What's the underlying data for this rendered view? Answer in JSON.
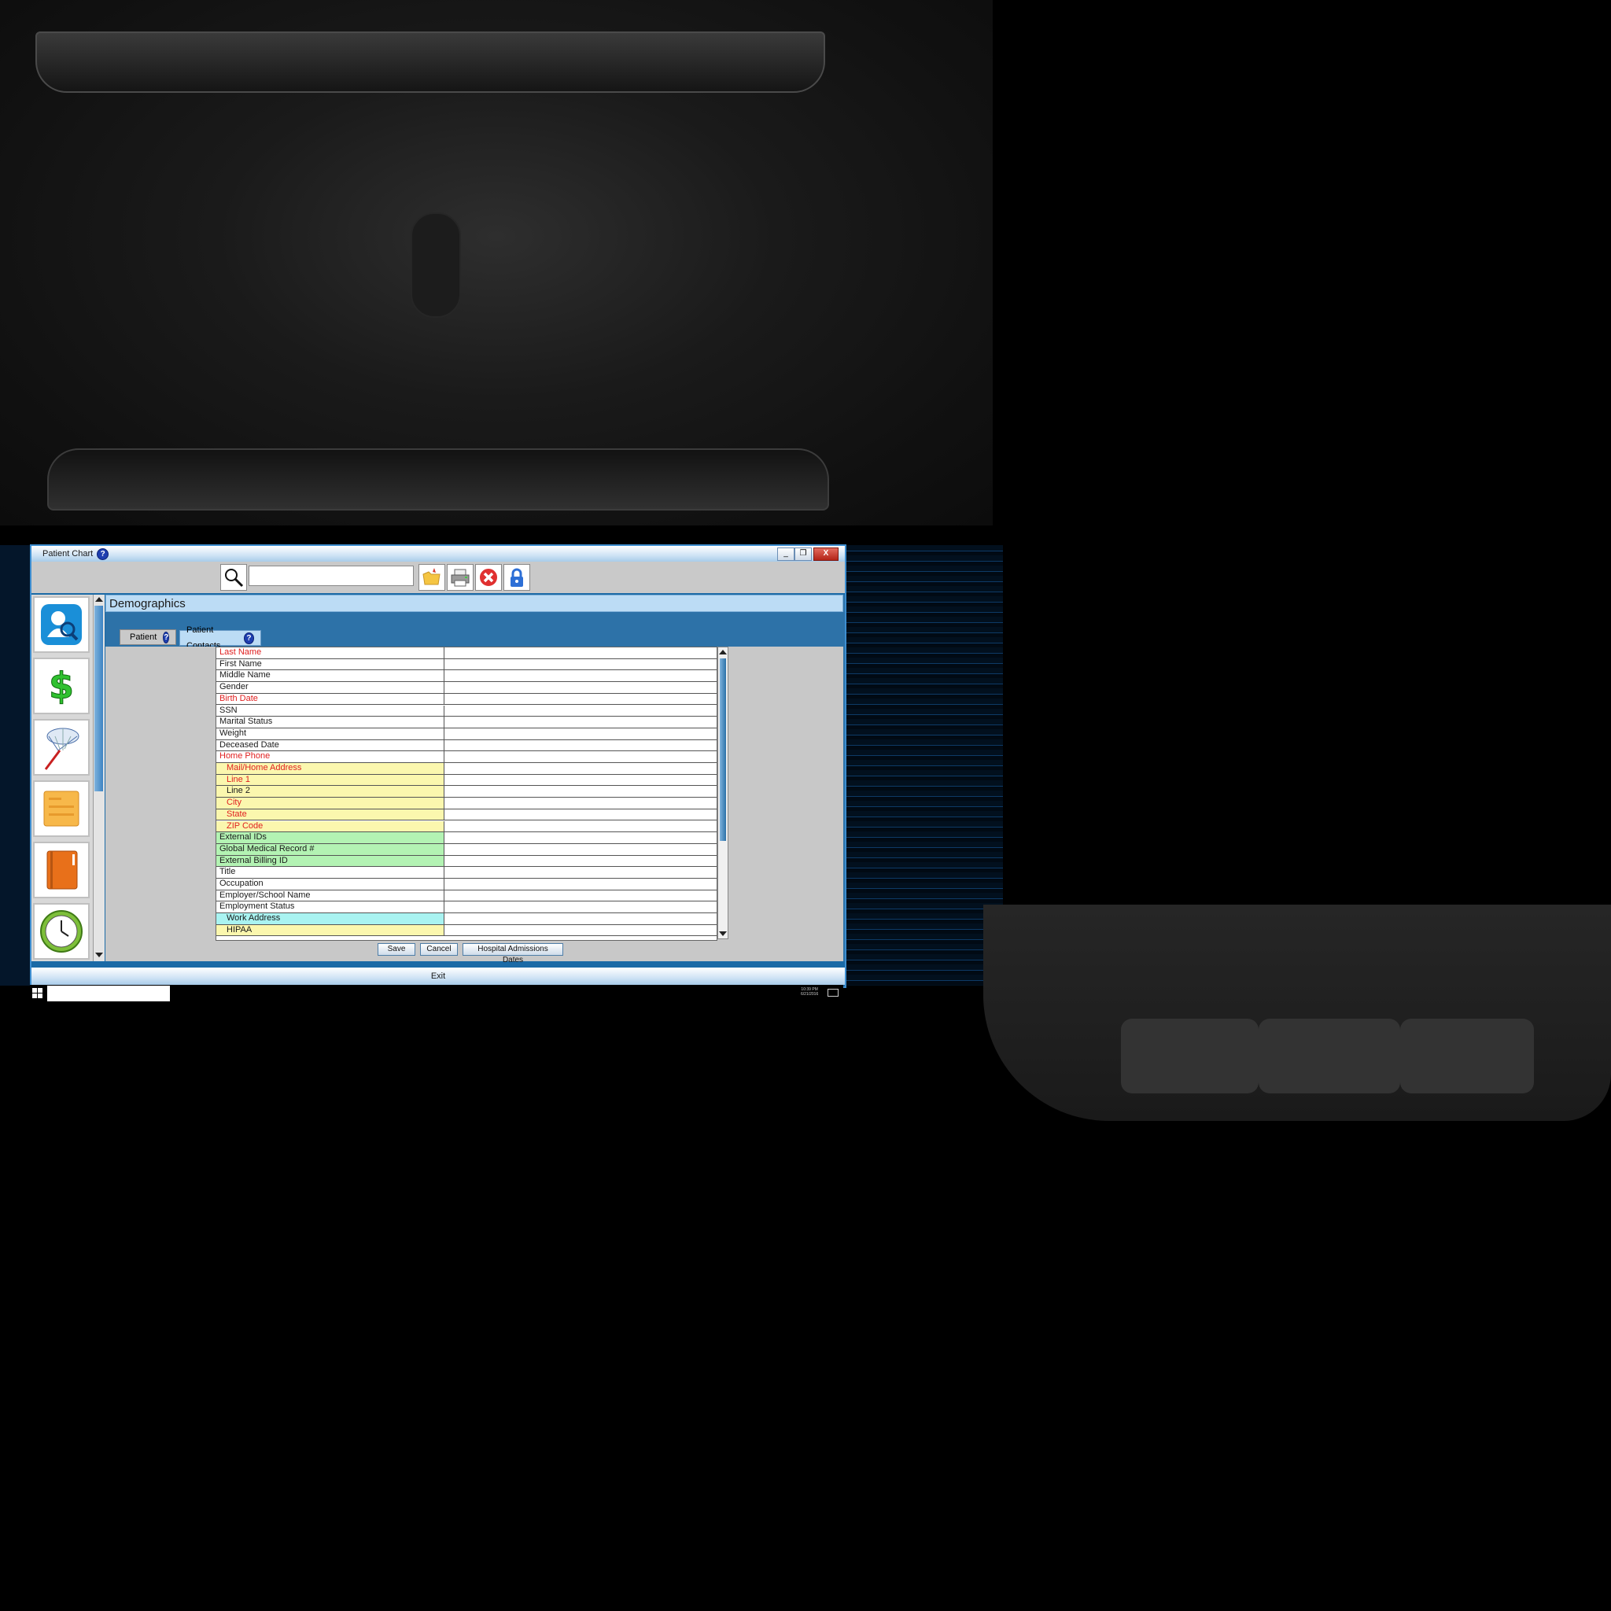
{
  "window": {
    "title": "Patient Chart",
    "help_glyph": "?",
    "minimize_glyph": "_",
    "restore_glyph": "❐",
    "close_glyph": "X"
  },
  "toolbar": {
    "search_value": "",
    "icons": [
      "search-icon",
      "folder-icon",
      "print-icon",
      "cancel-icon",
      "lock-icon"
    ]
  },
  "sidebar": {
    "items": [
      "patient-search-icon",
      "billing-dollar-icon",
      "net-icon",
      "notes-icon",
      "book-icon",
      "clock-icon"
    ]
  },
  "section": {
    "title": "Demographics"
  },
  "tabs": [
    {
      "label": "Patient",
      "help": "?"
    },
    {
      "label": "Patient Contacts",
      "help": "?"
    }
  ],
  "fields": [
    {
      "label": "Last Name",
      "style": "red",
      "value": ""
    },
    {
      "label": "First Name",
      "style": "plain",
      "value": ""
    },
    {
      "label": "Middle Name",
      "style": "plain",
      "value": ""
    },
    {
      "label": "Gender",
      "style": "plain",
      "value": ""
    },
    {
      "label": "Birth Date",
      "style": "red",
      "value": ""
    },
    {
      "label": "SSN",
      "style": "plain",
      "value": ""
    },
    {
      "label": "Marital Status",
      "style": "plain",
      "value": ""
    },
    {
      "label": "Weight",
      "style": "plain",
      "value": ""
    },
    {
      "label": "Deceased Date",
      "style": "plain",
      "value": ""
    },
    {
      "label": "Home Phone",
      "style": "red",
      "value": ""
    },
    {
      "label": "Mail/Home Address",
      "style": "yellow-red-indent",
      "value": ""
    },
    {
      "label": "Line 1",
      "style": "yellow-red-indent",
      "value": ""
    },
    {
      "label": "Line 2",
      "style": "yellow-indent",
      "value": ""
    },
    {
      "label": "City",
      "style": "yellow-red-indent",
      "value": ""
    },
    {
      "label": "State",
      "style": "yellow-red-indent",
      "value": ""
    },
    {
      "label": "ZIP Code",
      "style": "yellow-red-indent",
      "value": ""
    },
    {
      "label": "External IDs",
      "style": "green",
      "value": ""
    },
    {
      "label": "Global Medical Record #",
      "style": "green",
      "value": ""
    },
    {
      "label": "External Billing ID",
      "style": "green",
      "value": ""
    },
    {
      "label": "Title",
      "style": "plain",
      "value": ""
    },
    {
      "label": "Occupation",
      "style": "plain",
      "value": ""
    },
    {
      "label": "Employer/School Name",
      "style": "plain",
      "value": ""
    },
    {
      "label": "Employment Status",
      "style": "plain",
      "value": ""
    },
    {
      "label": "Work Address",
      "style": "cyan-indent",
      "value": ""
    },
    {
      "label": "HIPAA",
      "style": "yellow-indent",
      "value": ""
    }
  ],
  "actions": {
    "save": "Save",
    "cancel": "Cancel",
    "hospital": "Hospital Admissions Dates"
  },
  "exit_label": "Exit",
  "taskbar": {
    "time": "10:39 PM",
    "date": "6/21/2016"
  },
  "colors": {
    "window_blue": "#1b6aa6",
    "required_red": "#e02020",
    "address_yellow": "#fbf7ae",
    "ids_green": "#b3f3b3",
    "work_cyan": "#a9f3f1"
  }
}
